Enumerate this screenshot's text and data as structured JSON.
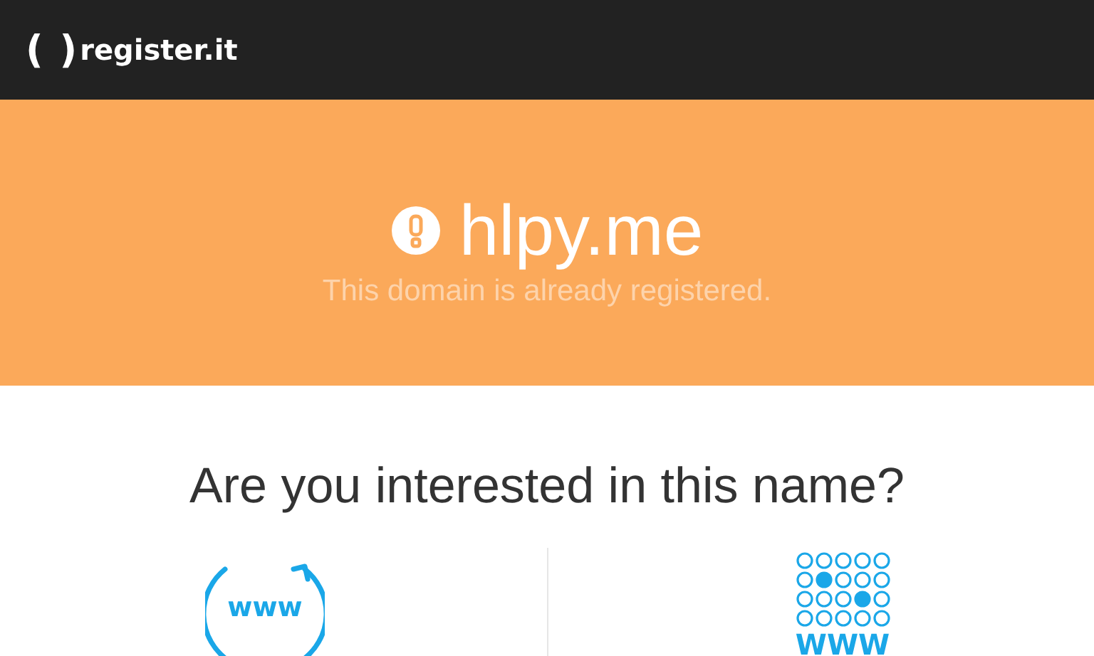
{
  "header": {
    "logo_brackets": "( )",
    "logo_text": "register.it"
  },
  "banner": {
    "domain": "hlpy.me",
    "message": "This domain is already registered."
  },
  "question": "Are you interested in this name?",
  "options": [
    {
      "kind": "renew",
      "icon_text": "www"
    },
    {
      "kind": "grid",
      "icon_text": "WWW"
    }
  ]
}
